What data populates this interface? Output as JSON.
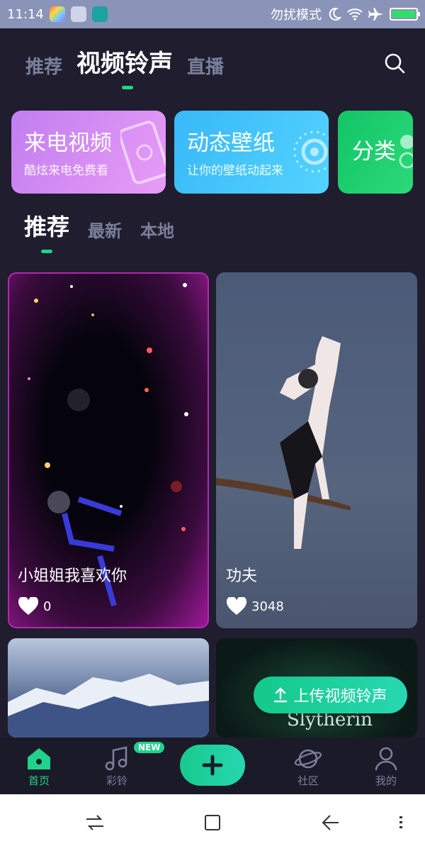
{
  "status": {
    "time": "11:14",
    "mode": "勿扰模式"
  },
  "top_tabs": [
    "推荐",
    "视频铃声",
    "直播"
  ],
  "feature_cards": [
    {
      "title": "来电视频",
      "subtitle": "酷炫来电免费看"
    },
    {
      "title": "动态壁纸",
      "subtitle": "让你的壁纸动起来"
    },
    {
      "title": "分类",
      "subtitle": ""
    }
  ],
  "sub_tabs": [
    "推荐",
    "最新",
    "本地"
  ],
  "videos": [
    {
      "title": "小姐姐我喜欢你",
      "likes": "0"
    },
    {
      "title": "功夫",
      "likes": "3048"
    },
    {
      "title": "",
      "likes": ""
    },
    {
      "title": "",
      "likes": "",
      "watermark": "Slytherin"
    }
  ],
  "upload_label": "上传视频铃声",
  "bottom_nav": [
    {
      "label": "首页",
      "icon": "home-icon"
    },
    {
      "label": "彩铃",
      "icon": "music-icon",
      "badge": "NEW"
    },
    {
      "label": "",
      "icon": "plus-icon"
    },
    {
      "label": "社区",
      "icon": "planet-icon"
    },
    {
      "label": "我的",
      "icon": "user-icon"
    }
  ],
  "colors": {
    "accent": "#1fd38c",
    "background": "#1f1d2e",
    "tab_inactive": "#7a7f9c"
  }
}
